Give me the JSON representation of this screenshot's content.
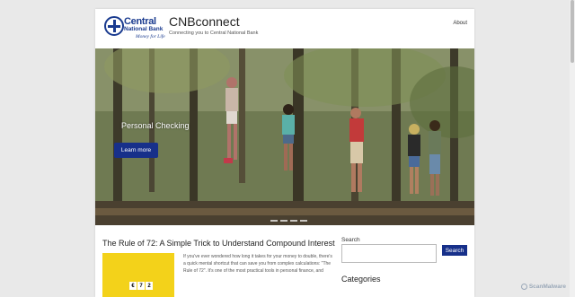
{
  "header": {
    "logo": {
      "word1": "Central",
      "word2": "National Bank",
      "tagline": "Money for Life"
    },
    "site_title": "CNBconnect",
    "site_description": "Connecting you to Central National Bank",
    "nav": {
      "about": "About"
    }
  },
  "hero": {
    "caption": "Personal Checking",
    "button_label": "Learn more",
    "slide_count": 4
  },
  "post": {
    "title": "The Rule of 72: A Simple Trick to Understand Compound Interest",
    "excerpt": "If you've ever wondered how long it takes for your money to double, there's a quick mental shortcut that can save you from complex calculations: \"The Rule of 72\". It's one of the most practical tools in personal finance, and",
    "thumbnail_blocks": [
      "€",
      "7",
      "2"
    ]
  },
  "sidebar": {
    "search_label": "Search",
    "search_button": "Search",
    "search_value": "",
    "categories_heading": "Categories"
  },
  "watermark": "ScanMalware",
  "colors": {
    "accent": "#17308a",
    "logo_blue": "#1a3b8f",
    "thumb_yellow": "#f3d21a"
  }
}
